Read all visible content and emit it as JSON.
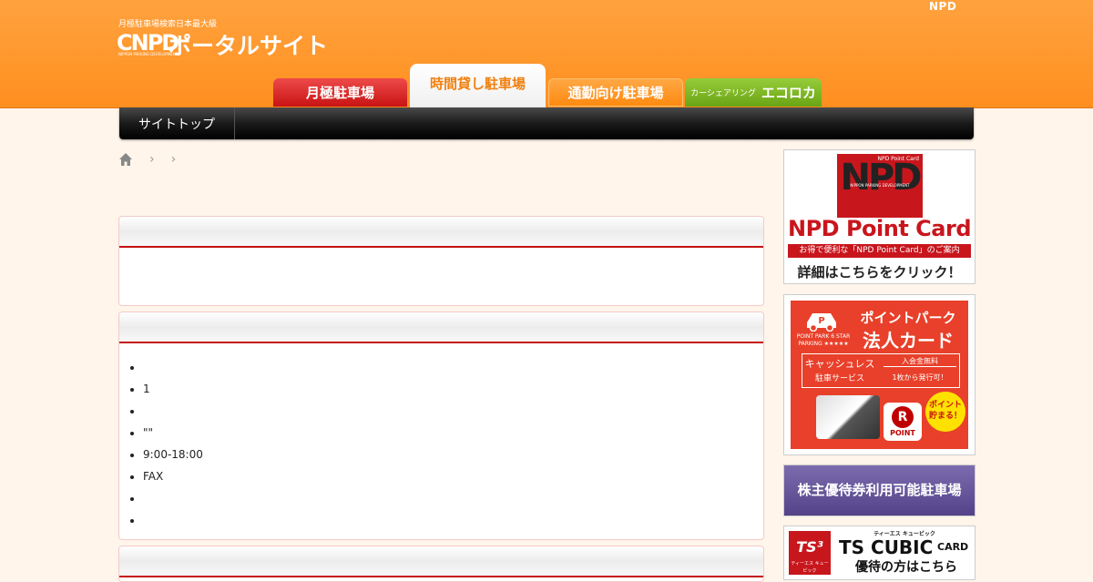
{
  "header": {
    "corner_label": "NPD",
    "logo_subtitle": "月極駐車場検索日本最大級",
    "logo_mark": "CNPD",
    "logo_mark_small": "NIPPON PARKING DEVELOPMENT",
    "logo_title": "ポータルサイト",
    "accent_color": "#ff951f"
  },
  "tabs": [
    {
      "label": "月極駐車場",
      "color": "#d41d1d"
    },
    {
      "label": "時間貸し駐車場",
      "color": "#f08010",
      "active": true
    },
    {
      "label": "通勤向け駐車場",
      "color": "#ff8a10"
    },
    {
      "prefix": "カーシェアリング",
      "label": "エコロカ",
      "color": "#7ab51f"
    }
  ],
  "nav": {
    "items": [
      "サイトトップ"
    ]
  },
  "breadcrumb": {
    "home_icon": "home-icon",
    "separator": "›"
  },
  "panels": {
    "details_list": [
      "",
      "1",
      "",
      "\"\"",
      "9:00-18:00",
      "FAX",
      "",
      ""
    ]
  },
  "sidebar": {
    "npd_card": {
      "mini_label": "NPD Point Card",
      "letters": "NPD",
      "company": "NIPPON PARKING DEVELOPMENT",
      "title": "NPD Point Card",
      "strip": "お得で便利な「NPD Point Card」のご案内",
      "click_text": "詳細はこちらをクリック！"
    },
    "point_park": {
      "brand": "POINT PARK 6 STAR PARKING ★★★★★",
      "title_line1": "ポイントパーク",
      "title_line2": "法人カード",
      "cashless": "キャッシュレス",
      "service": "駐車サービス",
      "free_fee": "入会金無料",
      "one_card": "1枚から発行可！",
      "r_letter": "R",
      "point_label": "POINT",
      "burst": "ポイント 貯まる！"
    },
    "stockholder": {
      "label": "株主優待券利用可能駐車場"
    },
    "ts_cubic": {
      "logo": "TS³",
      "logo_kana": "ティーエス キュービック",
      "small": "ティーエス キュービック",
      "big": "TS CUBIC",
      "card": "CARD",
      "sub": "優待の方はこちら"
    }
  }
}
